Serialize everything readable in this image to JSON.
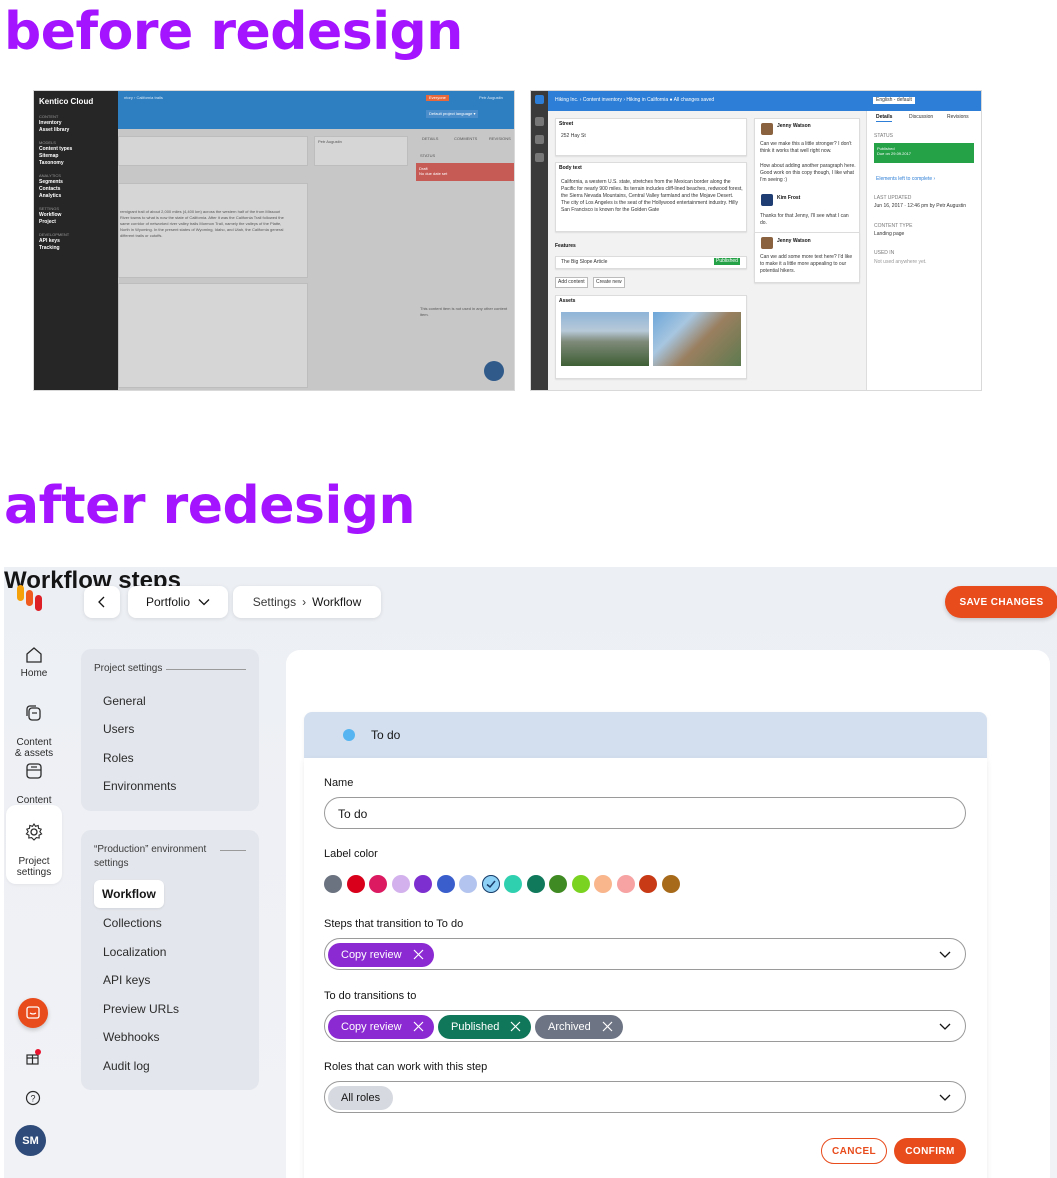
{
  "headings": {
    "before": "before redesign",
    "after": "after redesign"
  },
  "old_left": {
    "brand": "Kentico Cloud",
    "breadcrumb": "ntory  ›  California trails",
    "groups": [
      {
        "title": "CONTENT",
        "items": [
          "Inventory",
          "Asset library"
        ]
      },
      {
        "title": "MODELS",
        "items": [
          "Content types",
          "Sitemap",
          "Taxonomy"
        ]
      },
      {
        "title": "ANALYTICS",
        "items": [
          "Segments",
          "Contacts",
          "Analytics"
        ]
      },
      {
        "title": "SETTINGS",
        "items": [
          "Workflow",
          "Project"
        ]
      },
      {
        "title": "DEVELOPMENT",
        "items": [
          "API keys",
          "Tracking"
        ]
      }
    ],
    "language": "Default project language ▾",
    "tabs": [
      "DETAILS",
      "COMMENTS",
      "REVISIONS"
    ],
    "status_label": "STATUS",
    "status_value": "Draft",
    "status_sub": "No due date set",
    "author": "Petr Augustin",
    "body": "remigrant trail of about 2,000 miles (4,400 km) across the western half of the from Missouri River towns to what is now the state of California. After it was the California Trail followed the same corridor of networked river valley trails Mormon Trail, namely the valleys of the Platte, North in Wyoming. In the present states of Wyoming, Idaho, and Utah, the California general different trails or cutoffs.",
    "used_in": "This content item is not used in any other content item."
  },
  "old_right": {
    "topbar": "Hiking Inc.  ›  Content inventory  ›  Hiking in California   ● All changes saved",
    "language": "English - default",
    "tabs": [
      "Details",
      "Discussion",
      "Revisions"
    ],
    "street_label": "Street",
    "street_value": "252 Hay St",
    "body_label": "Body text",
    "body": "California, a western U.S. state, stretches from the Mexican border along the Pacific for nearly 900 miles. Its terrain includes cliff-lined beaches, redwood forest, the Sierra Nevada Mountains, Central Valley farmland and the Mojave Desert. The city of Los Angeles is the seat of the Hollywood entertainment industry. Hilly San Francisco is known for the Golden Gate",
    "features_label": "Features",
    "feature_item": "The Big Slope  Article",
    "feature_status": "Published",
    "add_content": "Add content",
    "create_new": "Create new",
    "assets_label": "Assets",
    "status_label": "STATUS",
    "status_value": "Published",
    "status_sub": "Due on 29.09.2017",
    "elements_left": "Elements left to complete ›",
    "last_updated_label": "LAST UPDATED",
    "last_updated": "Jun 16, 2017 · 12:46 pm by Petr Augustin",
    "content_type_label": "CONTENT TYPE",
    "content_type": "Landing page",
    "used_in_label": "USED IN",
    "used_in": "Not used anywhere yet.",
    "comments": [
      {
        "author": "Jenny Watson",
        "text": "Can we make this a little stronger? I don't think it works that well right now."
      },
      {
        "author": "",
        "text": "How about adding another paragraph here. Good work on this copy though, I like what I'm seeing :)"
      },
      {
        "author": "Kim Frost",
        "text": "Thanks for that Jenny, I'll see what I can do."
      },
      {
        "author": "Jenny Watson",
        "text": "Can we add some more text here? I'd like to make it a little more appealing to our potential hikers."
      }
    ]
  },
  "newui": {
    "nav": [
      {
        "label": "Home"
      },
      {
        "label": "Content\n& assets"
      },
      {
        "label": "Content\nmodel"
      },
      {
        "label": "Project\nsettings"
      }
    ],
    "nav_footer": {
      "avatar": "SM"
    },
    "project": "Portfolio",
    "breadcrumb": {
      "parent": "Settings",
      "sep": "›",
      "current": "Workflow"
    },
    "save": "SAVE CHANGES",
    "project_settings": {
      "title": "Project settings",
      "items": [
        "General",
        "Users",
        "Roles",
        "Environments"
      ]
    },
    "env_settings": {
      "title": "“Production” environment settings",
      "items": [
        "Workflow",
        "Collections",
        "Localization",
        "API keys",
        "Preview URLs",
        "Webhooks",
        "Audit log"
      ],
      "active": "Workflow"
    },
    "main": {
      "title": "Workflow steps",
      "step_name": "To do",
      "step_color": "#56b5f0",
      "name_label": "Name",
      "name_value": "To do",
      "color_label": "Label color",
      "colors": [
        "#6b7280",
        "#d8001a",
        "#db1a62",
        "#d3b1ec",
        "#7e2fcf",
        "#3a5fcd",
        "#b3c4ee",
        "#8ed1f6",
        "#2fd0b0",
        "#10795c",
        "#3f8a22",
        "#7bd321",
        "#f9b58c",
        "#f7a3a3",
        "#c83a16",
        "#a66a1a"
      ],
      "selected_color_index": 7,
      "transition_in_label": "Steps that transition to To do",
      "transition_in": [
        {
          "label": "Copy review",
          "color": "#8b2ad2"
        }
      ],
      "transition_out_label": "To do transitions to",
      "transition_out": [
        {
          "label": "Copy review",
          "color": "#8b2ad2"
        },
        {
          "label": "Published",
          "color": "#11775a"
        },
        {
          "label": "Archived",
          "color": "#6d7483"
        }
      ],
      "roles_label": "Roles that can work with this step",
      "roles": "All roles",
      "cancel": "CANCEL",
      "confirm": "CONFIRM"
    }
  }
}
